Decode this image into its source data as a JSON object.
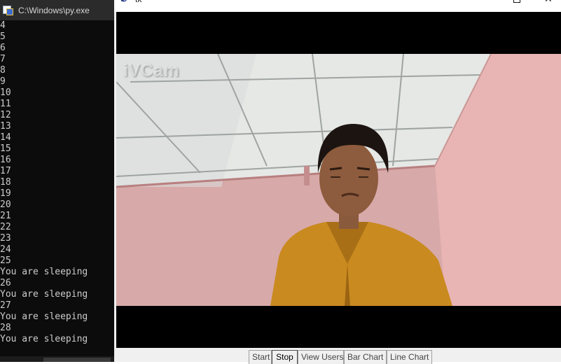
{
  "console": {
    "title": "C:\\Windows\\py.exe",
    "lines": [
      "4",
      "5",
      "6",
      "7",
      "8",
      "9",
      "10",
      "11",
      "12",
      "13",
      "14",
      "15",
      "16",
      "17",
      "18",
      "19",
      "20",
      "21",
      "22",
      "23",
      "24",
      "25",
      "You are sleeping",
      "26",
      "You are sleeping",
      "27",
      "You are sleeping",
      "28",
      "You are sleeping"
    ]
  },
  "tk": {
    "title": "tk",
    "watermark": "iVCam",
    "buttons": [
      "Start",
      "Stop",
      "View Users",
      "Bar Chart",
      "Line Chart"
    ],
    "active_button": "Stop"
  },
  "colors": {
    "console_bg": "#0c0c0c",
    "console_text": "#cccccc",
    "wall": "#d7a9a9",
    "shirt": "#c98a1f"
  }
}
